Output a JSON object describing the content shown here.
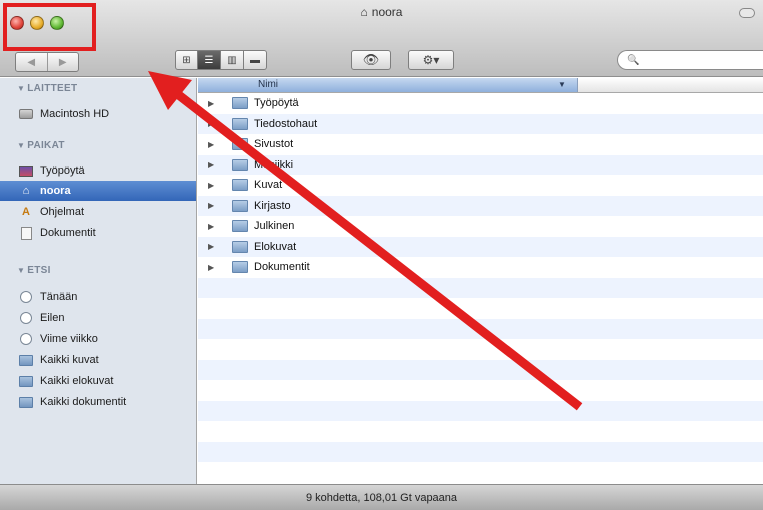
{
  "window": {
    "title": "noora",
    "title_icon": "home-icon",
    "status": "9 kohdetta, 108,01 Gt vapaana"
  },
  "toolbar": {
    "back_glyph": "◀",
    "forward_glyph": "▶",
    "view_icons": [
      "icon-view-icon",
      "list-view-icon",
      "column-view-icon",
      "coverflow-view-icon"
    ],
    "active_view": "list-view-icon",
    "quicklook_glyph": "👁",
    "action_glyph": "⚙▾",
    "search_glyph": "🔍",
    "search_value": ""
  },
  "sidebar": {
    "devices_header": "LAITTEET",
    "devices": [
      {
        "label": "Macintosh HD",
        "icon": "hard-drive-icon"
      }
    ],
    "places_header": "PAIKAT",
    "places": [
      {
        "label": "Työpöytä",
        "icon": "desktop-icon"
      },
      {
        "label": "noora",
        "icon": "home-icon",
        "selected": true
      },
      {
        "label": "Ohjelmat",
        "icon": "applications-icon"
      },
      {
        "label": "Dokumentit",
        "icon": "documents-icon"
      }
    ],
    "search_header": "ETSI",
    "searches": [
      {
        "label": "Tänään",
        "icon": "clock-icon"
      },
      {
        "label": "Eilen",
        "icon": "clock-icon"
      },
      {
        "label": "Viime viikko",
        "icon": "clock-icon"
      },
      {
        "label": "Kaikki kuvat",
        "icon": "smart-folder-icon"
      },
      {
        "label": "Kaikki elokuvat",
        "icon": "smart-folder-icon"
      },
      {
        "label": "Kaikki dokumentit",
        "icon": "smart-folder-icon"
      }
    ]
  },
  "filelist": {
    "column_name": "Nimi",
    "items": [
      "Työpöytä",
      "Tiedostohaut",
      "Sivustot",
      "Musiikki",
      "Kuvat",
      "Kirjasto",
      "Julkinen",
      "Elokuvat",
      "Dokumentit"
    ]
  },
  "colors": {
    "annotation_red": "#e21f1f",
    "selection_blue": "#3366b8",
    "sidebar_bg": "#dfe5ed",
    "row_alt": "#edf3fe"
  }
}
